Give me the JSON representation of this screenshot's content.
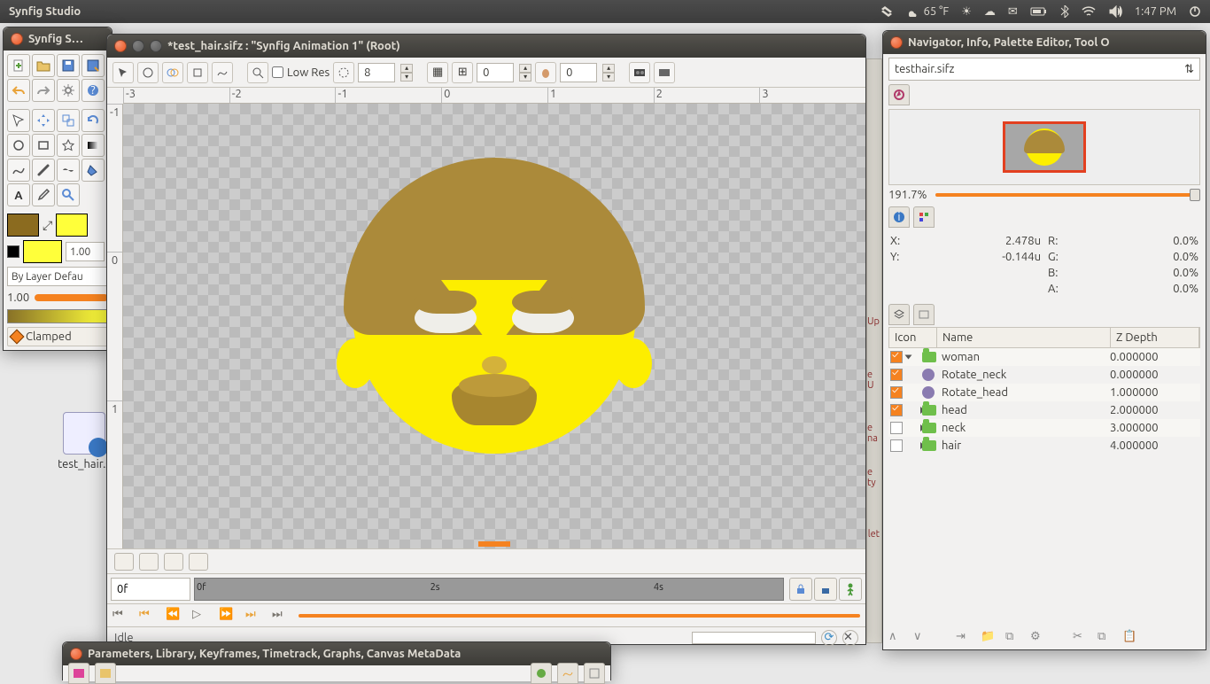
{
  "menubar": {
    "appname": "Synfig Studio",
    "temp": "65 °F",
    "clock": "1:47 PM"
  },
  "toolbox": {
    "title": "Synfig S…",
    "opacity_value": "1.00",
    "blend_label": "By Layer Defau",
    "slider_value": "1.00",
    "clamped": "Clamped",
    "colors": {
      "outline": "#8b6b1f",
      "fill": "#ffff3a",
      "bg": "#000000"
    }
  },
  "desktop_file": "test_hair.s",
  "canvas": {
    "title": "*test_hair.sifz : \"Synfig Animation 1\" (Root)",
    "lowres": "Low Res",
    "quality": "8",
    "field1": "0",
    "field2": "0",
    "ruler_h": [
      "-3",
      "-2",
      "-1",
      "0",
      "1",
      "2",
      "3"
    ],
    "ruler_v": [
      "-1",
      "0",
      "1"
    ],
    "time_field": "0f",
    "tl_labels": [
      "0f",
      "2s",
      "4s"
    ],
    "status": "Idle"
  },
  "navigator": {
    "title": "Navigator, Info, Palette Editor, Tool O",
    "filename": "testhair.sifz",
    "zoom": "191.7%",
    "info": {
      "X": "2.478u",
      "Y": "-0.144u",
      "R": "0.0%",
      "G": "0.0%",
      "B": "0.0%",
      "A": "0.0%"
    },
    "columns": {
      "icon": "Icon",
      "name": "Name",
      "z": "Z Depth"
    },
    "layers": [
      {
        "checked": true,
        "expandable": true,
        "open": true,
        "kind": "folder",
        "indent": 0,
        "name": "woman",
        "z": "0.000000"
      },
      {
        "checked": true,
        "expandable": false,
        "open": false,
        "kind": "gear",
        "indent": 1,
        "name": "Rotate_neck",
        "z": "0.000000"
      },
      {
        "checked": true,
        "expandable": false,
        "open": false,
        "kind": "gear",
        "indent": 1,
        "name": "Rotate_head",
        "z": "1.000000"
      },
      {
        "checked": true,
        "expandable": true,
        "open": false,
        "kind": "folder",
        "indent": 1,
        "name": "head",
        "z": "2.000000"
      },
      {
        "checked": false,
        "expandable": true,
        "open": false,
        "kind": "folder",
        "indent": 1,
        "name": "neck",
        "z": "3.000000"
      },
      {
        "checked": false,
        "expandable": true,
        "open": false,
        "kind": "folder",
        "indent": 1,
        "name": "hair",
        "z": "4.000000"
      }
    ]
  },
  "params": {
    "title": "Parameters, Library, Keyframes, Timetrack, Graphs, Canvas MetaData"
  },
  "bg_hints": [
    "Up",
    "e U",
    "e na",
    "e ty",
    "let"
  ]
}
